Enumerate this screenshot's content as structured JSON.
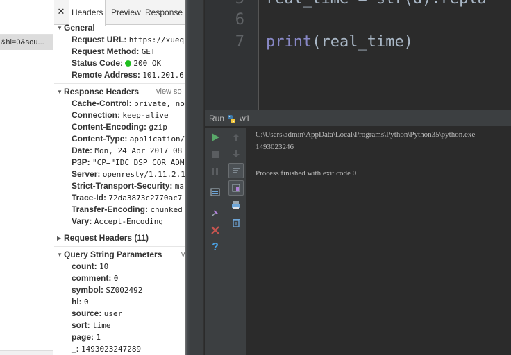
{
  "request_list": {
    "selected_row_text": "&hl=0&sou..."
  },
  "devtools": {
    "tabs": [
      {
        "label": "Headers",
        "active": true
      },
      {
        "label": "Preview",
        "active": false
      },
      {
        "label": "Response",
        "active": false
      }
    ],
    "close_glyph": "✕",
    "general": {
      "title": "General",
      "request_url_key": "Request URL:",
      "request_url_val": "https://xueq",
      "method_key": "Request Method:",
      "method_val": "GET",
      "status_key": "Status Code:",
      "status_val": "200 OK",
      "remote_key": "Remote Address:",
      "remote_val": "101.201.6"
    },
    "response_headers": {
      "title": "Response Headers",
      "view_source": "view so",
      "items": [
        {
          "k": "Cache-Control:",
          "v": "private, no"
        },
        {
          "k": "Connection:",
          "v": "keep-alive"
        },
        {
          "k": "Content-Encoding:",
          "v": "gzip"
        },
        {
          "k": "Content-Type:",
          "v": "application/"
        },
        {
          "k": "Date:",
          "v": "Mon, 24 Apr 2017 08"
        },
        {
          "k": "P3P:",
          "v": "\"CP=\"IDC DSP COR ADM"
        },
        {
          "k": "Server:",
          "v": "openresty/1.11.2.1"
        },
        {
          "k": "Strict-Transport-Security:",
          "v": "ma"
        },
        {
          "k": "Trace-Id:",
          "v": "72da3873c2770ac7"
        },
        {
          "k": "Transfer-Encoding:",
          "v": "chunked"
        },
        {
          "k": "Vary:",
          "v": "Accept-Encoding"
        }
      ]
    },
    "request_headers": {
      "title": "Request Headers (11)"
    },
    "query_params": {
      "title": "Query String Parameters",
      "view_source": "v",
      "items": [
        {
          "k": "count:",
          "v": "10"
        },
        {
          "k": "comment:",
          "v": "0"
        },
        {
          "k": "symbol:",
          "v": "SZ002492"
        },
        {
          "k": "hl:",
          "v": "0"
        },
        {
          "k": "source:",
          "v": "user"
        },
        {
          "k": "sort:",
          "v": "time"
        },
        {
          "k": "page:",
          "v": "1"
        },
        {
          "k": "_:",
          "v": "1493023247289"
        }
      ]
    }
  },
  "ide": {
    "line_numbers": [
      "5",
      "6",
      "7"
    ],
    "code_line1": "real_time = str(d).repla",
    "code_print_fn": "print",
    "code_print_rest": "(real_time)",
    "run_label": "Run",
    "run_config": "w1",
    "console_lines": [
      "C:\\Users\\admin\\AppData\\Local\\Programs\\Python\\Python35\\python.exe",
      "1493023246",
      "",
      "Process finished with exit code 0"
    ],
    "colors": {
      "background": "#2b2b2b",
      "code_text": "#a9b7c6",
      "builtin_fn": "#8888c6",
      "run_green": "#59a869",
      "stop_red": "#c75450"
    }
  }
}
